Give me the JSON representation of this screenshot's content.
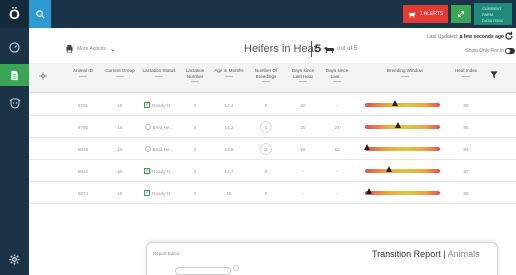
{
  "app": {
    "logo_glyph": "Ö",
    "alert_label": "1 ALERTS",
    "farm_label": [
      "CURRENT",
      "FARM",
      "DATA ITEM"
    ]
  },
  "sidebar": {
    "items": [
      {
        "icon": "gauge-icon"
      },
      {
        "icon": "document-icon",
        "active": true
      },
      {
        "icon": "cow-icon"
      },
      {
        "icon": "gear-icon"
      }
    ]
  },
  "toolbar": {
    "actions_label": "More Actions",
    "last_updated_prefix": "Last Updated: ",
    "last_updated_value": "a few seconds ago",
    "show_only_label": "Show Only For In",
    "page_title": "Heifers in Heat",
    "count": "5",
    "count_of": "out of 5"
  },
  "table": {
    "columns": [
      "Animal ID",
      "Current Group",
      "Lactation Status",
      "Lactation Number",
      "Age in Months",
      "Number Of Breedings",
      "Days since Last Heat",
      "Days since Last...",
      "Breeding Window",
      "Heat Index"
    ],
    "rows": [
      {
        "animal_id": "9781",
        "group": "15",
        "status": "Ready H...",
        "status_icon": "check",
        "lact": "0",
        "age": "14.4",
        "breedings": "0",
        "days_heat": "20",
        "days_last": "-",
        "marker": 0.4,
        "heat_index": "86"
      },
      {
        "animal_id": "9785",
        "group": "15",
        "status": "Bred He...",
        "status_icon": "ring",
        "lact": "0",
        "age": "14.2",
        "breedings": "1",
        "days_heat": "20",
        "days_last": "21",
        "marker": 0.44,
        "heat_index": "86"
      },
      {
        "animal_id": "9818",
        "group": "15",
        "status": "Bred He...",
        "status_icon": "ring",
        "lact": "0",
        "age": "13.8",
        "breedings": "2",
        "days_heat": "19",
        "days_last": "13",
        "marker": 0.03,
        "heat_index": "84"
      },
      {
        "animal_id": "9822",
        "group": "15",
        "status": "Ready H...",
        "status_icon": "check",
        "lact": "0",
        "age": "13.7",
        "breedings": "0",
        "days_heat": "-",
        "days_last": "-",
        "marker": 0.32,
        "heat_index": "87"
      },
      {
        "animal_id": "9874",
        "group": "15",
        "status": "Ready H...",
        "status_icon": "check",
        "lact": "0",
        "age": "15",
        "breedings": "0",
        "days_heat": "-",
        "days_last": "-",
        "marker": 0.05,
        "heat_index": "88"
      }
    ]
  },
  "report": {
    "editor_label": "Report Editor",
    "title": "Transition Report",
    "subtitle": "Animals"
  },
  "colors": {
    "nav_dark": "#1b3347",
    "accent_blue": "#2b9bd1",
    "alert_red": "#e53935",
    "accent_green": "#3aa655"
  }
}
